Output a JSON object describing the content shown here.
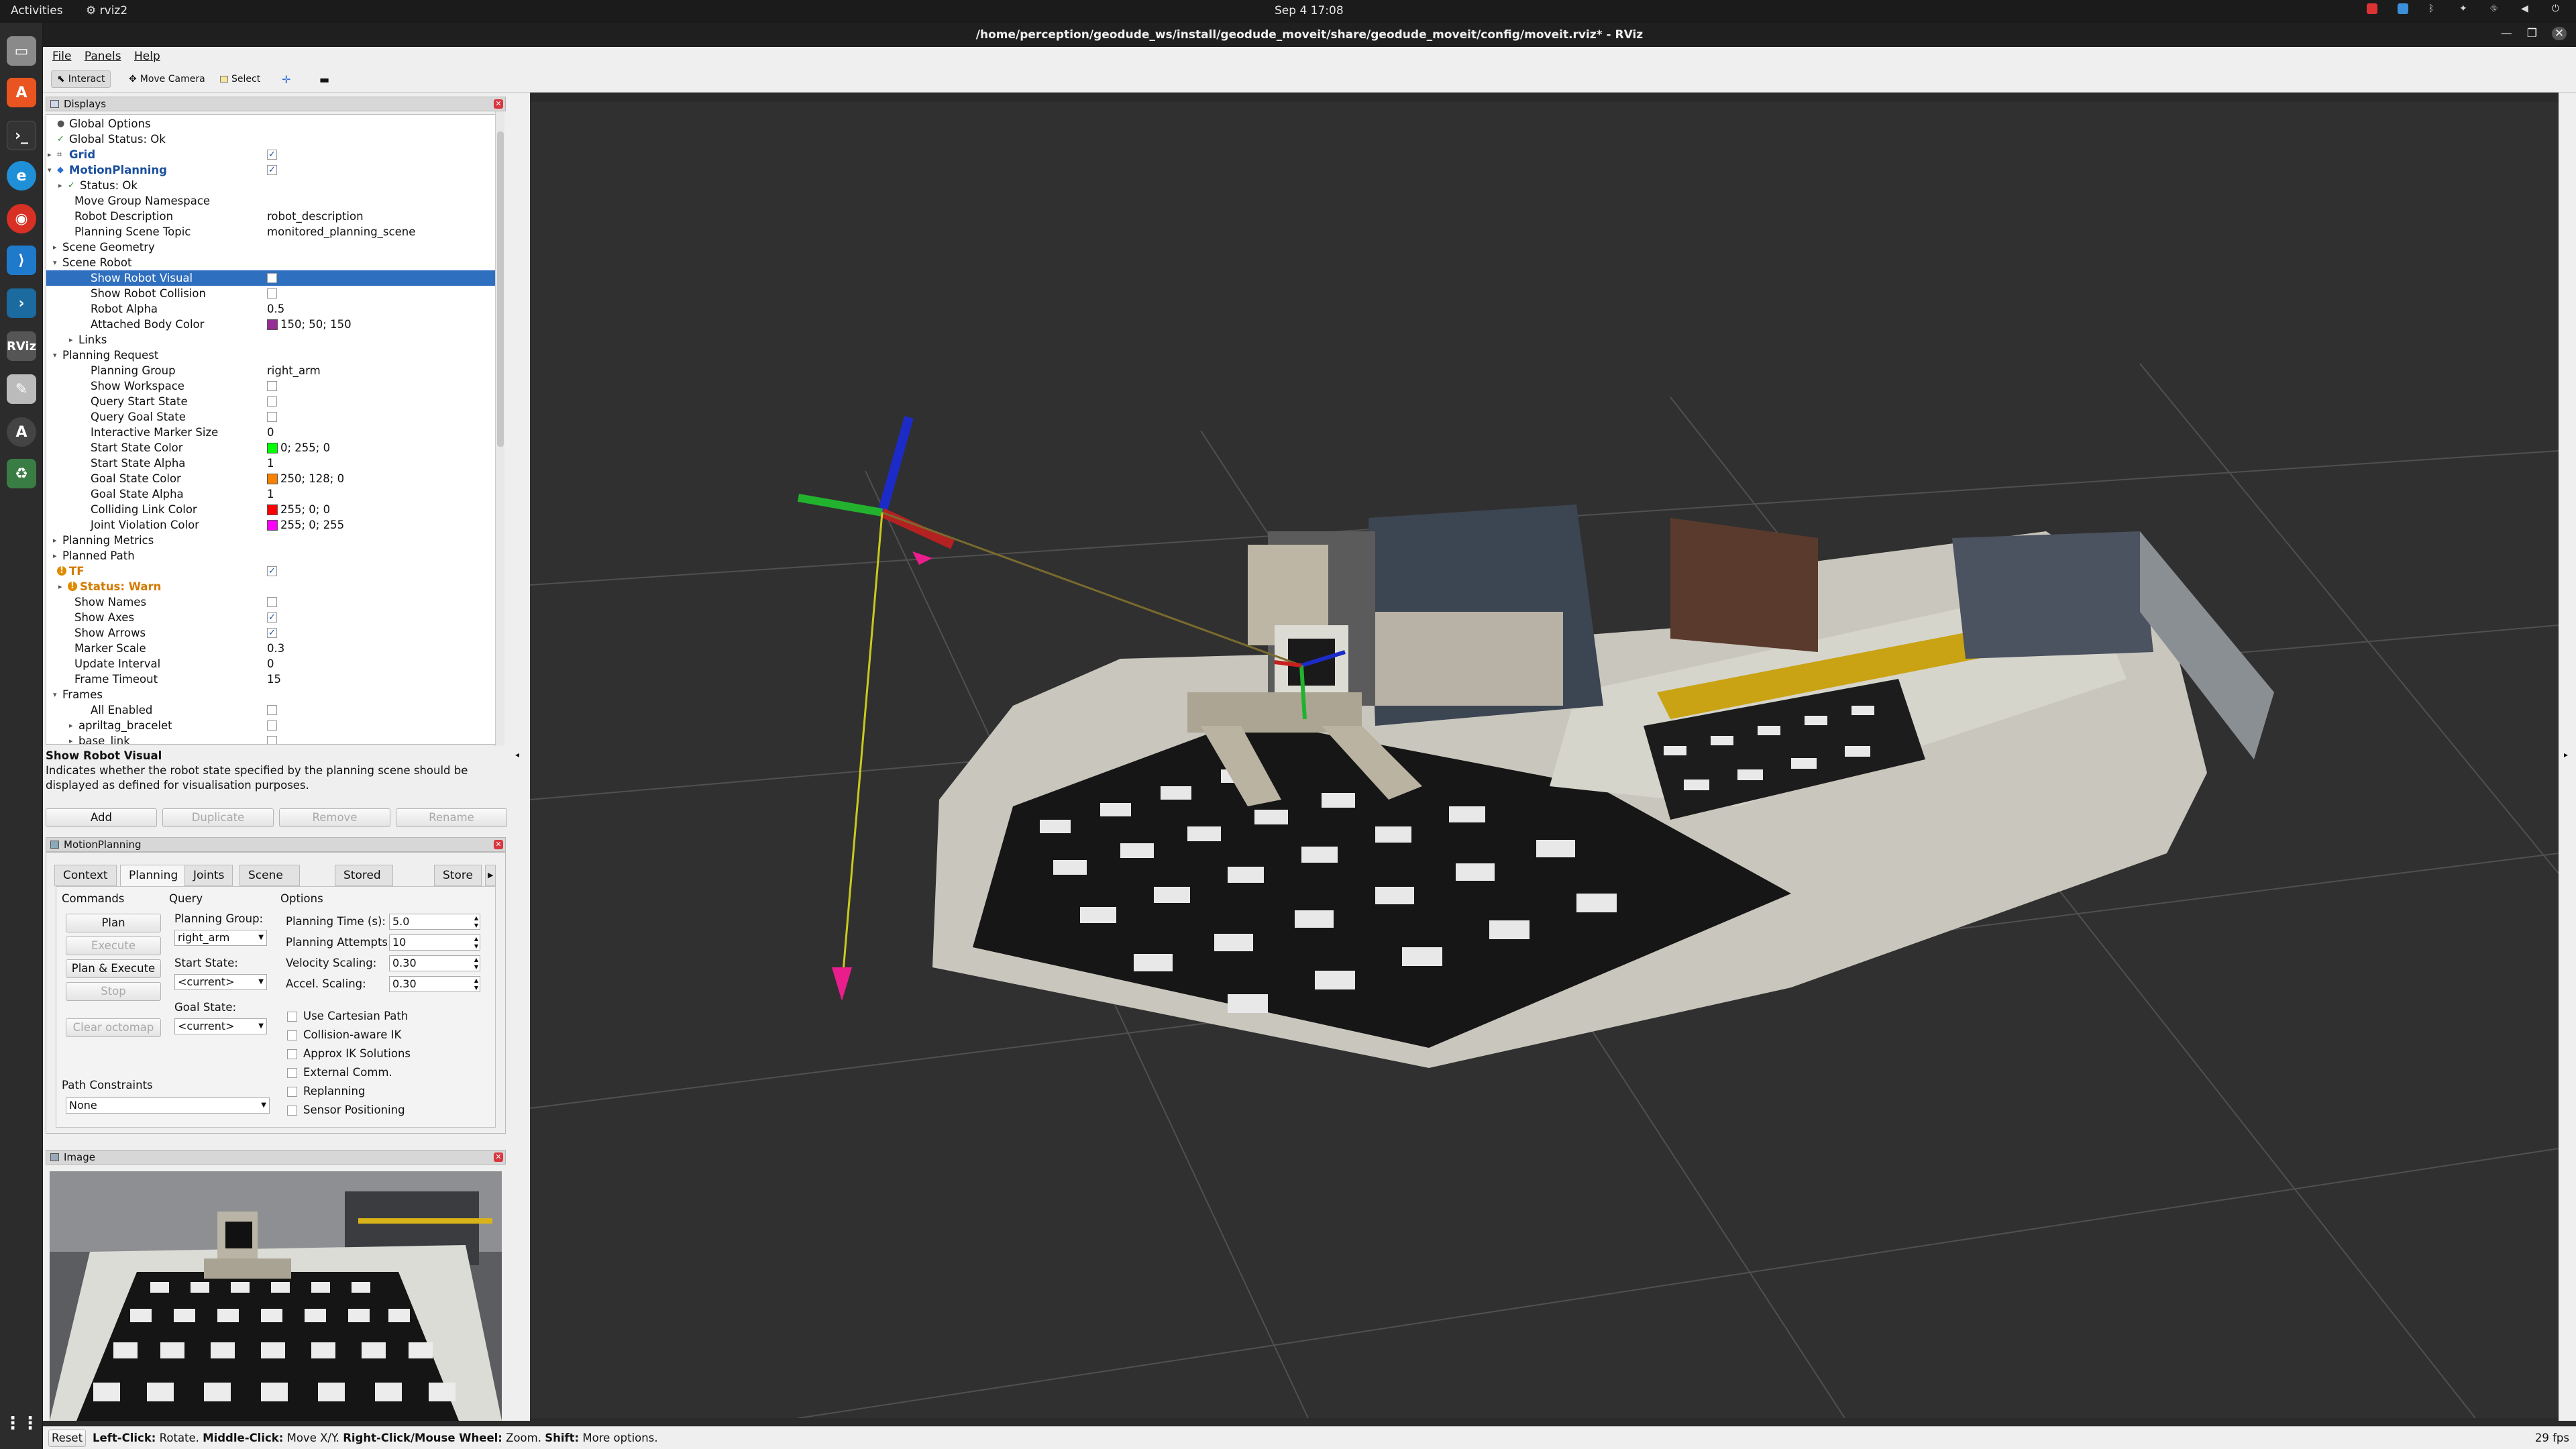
{
  "topbar": {
    "activities": "Activities",
    "app": "rviz2",
    "clock": "Sep 4  17:08"
  },
  "window": {
    "title": "/home/perception/geodude_ws/install/geodude_moveit/share/geodude_moveit/config/moveit.rviz* - RViz"
  },
  "menu": {
    "file": "File",
    "panels": "Panels",
    "help": "Help"
  },
  "toolbar": {
    "interact": "Interact",
    "move_camera": "Move Camera",
    "select": "Select"
  },
  "displays": {
    "title": "Displays",
    "rows": [
      {
        "label": "Global Options",
        "value": ""
      },
      {
        "label": "Global Status: Ok",
        "value": ""
      },
      {
        "label": "Grid",
        "value": ""
      },
      {
        "label": "MotionPlanning",
        "value": ""
      },
      {
        "label": "Status: Ok",
        "value": ""
      },
      {
        "label": "Move Group Namespace",
        "value": ""
      },
      {
        "label": "Robot Description",
        "value": "robot_description"
      },
      {
        "label": "Planning Scene Topic",
        "value": "monitored_planning_scene"
      },
      {
        "label": "Scene Geometry",
        "value": ""
      },
      {
        "label": "Scene Robot",
        "value": ""
      },
      {
        "label": "Show Robot Visual",
        "value": ""
      },
      {
        "label": "Show Robot Collision",
        "value": ""
      },
      {
        "label": "Robot Alpha",
        "value": "0.5"
      },
      {
        "label": "Attached Body Color",
        "value": "150; 50; 150"
      },
      {
        "label": "Links",
        "value": ""
      },
      {
        "label": "Planning Request",
        "value": ""
      },
      {
        "label": "Planning Group",
        "value": "right_arm"
      },
      {
        "label": "Show Workspace",
        "value": ""
      },
      {
        "label": "Query Start State",
        "value": ""
      },
      {
        "label": "Query Goal State",
        "value": ""
      },
      {
        "label": "Interactive Marker Size",
        "value": "0"
      },
      {
        "label": "Start State Color",
        "value": "0; 255; 0"
      },
      {
        "label": "Start State Alpha",
        "value": "1"
      },
      {
        "label": "Goal State Color",
        "value": "250; 128; 0"
      },
      {
        "label": "Goal State Alpha",
        "value": "1"
      },
      {
        "label": "Colliding Link Color",
        "value": "255; 0; 0"
      },
      {
        "label": "Joint Violation Color",
        "value": "255; 0; 255"
      },
      {
        "label": "Planning Metrics",
        "value": ""
      },
      {
        "label": "Planned Path",
        "value": ""
      },
      {
        "label": "TF",
        "value": ""
      },
      {
        "label": "Status: Warn",
        "value": ""
      },
      {
        "label": "Show Names",
        "value": ""
      },
      {
        "label": "Show Axes",
        "value": ""
      },
      {
        "label": "Show Arrows",
        "value": ""
      },
      {
        "label": "Marker Scale",
        "value": "0.3"
      },
      {
        "label": "Update Interval",
        "value": "0"
      },
      {
        "label": "Frame Timeout",
        "value": "15"
      },
      {
        "label": "Frames",
        "value": ""
      },
      {
        "label": "All Enabled",
        "value": ""
      },
      {
        "label": "apriltag_bracelet",
        "value": ""
      },
      {
        "label": "base_link",
        "value": ""
      }
    ],
    "desc_title": "Show Robot Visual",
    "desc_text": "Indicates whether the robot state specified by the planning scene should be displayed as defined for visualisation purposes.",
    "buttons": {
      "add": "Add",
      "duplicate": "Duplicate",
      "remove": "Remove",
      "rename": "Rename"
    }
  },
  "colors": {
    "attached": "#962d96",
    "start": "#00ff00",
    "goal": "#fa8000",
    "colliding": "#ff0000",
    "violation": "#ff00ff",
    "selection": "#2f6fbf"
  },
  "motion": {
    "title": "MotionPlanning",
    "tabs": [
      "Context",
      "Planning",
      "Joints",
      "Scene Objects",
      "Stored Scenes",
      "Store"
    ],
    "commands_label": "Commands",
    "query_label": "Query",
    "options_label": "Options",
    "plan": "Plan",
    "execute": "Execute",
    "plan_execute": "Plan & Execute",
    "stop": "Stop",
    "clear_octomap": "Clear octomap",
    "planning_group_label": "Planning Group:",
    "planning_group": "right_arm",
    "start_state_label": "Start State:",
    "start_state": "<current>",
    "goal_state_label": "Goal State:",
    "goal_state": "<current>",
    "planning_time_label": "Planning Time (s):",
    "planning_time": "5.0",
    "planning_attempts_label": "Planning Attempts:",
    "planning_attempts": "10",
    "velocity_label": "Velocity Scaling:",
    "velocity": "0.30",
    "accel_label": "Accel. Scaling:",
    "accel": "0.30",
    "opt_cartesian": "Use Cartesian Path",
    "opt_collision_ik": "Collision-aware IK",
    "opt_approx": "Approx IK Solutions",
    "opt_external": "External Comm.",
    "opt_replanning": "Replanning",
    "opt_sensor": "Sensor Positioning",
    "path_constraints_label": "Path Constraints",
    "path_constraints": "None"
  },
  "image_panel": {
    "title": "Image"
  },
  "status": {
    "reset": "Reset",
    "b1": "Left-Click:",
    "t1": "Rotate.",
    "b2": "Middle-Click:",
    "t2": "Move X/Y.",
    "b3": "Right-Click/Mouse Wheel:",
    "t3": "Zoom.",
    "b4": "Shift:",
    "t4": "More options.",
    "fps": "29 fps"
  }
}
